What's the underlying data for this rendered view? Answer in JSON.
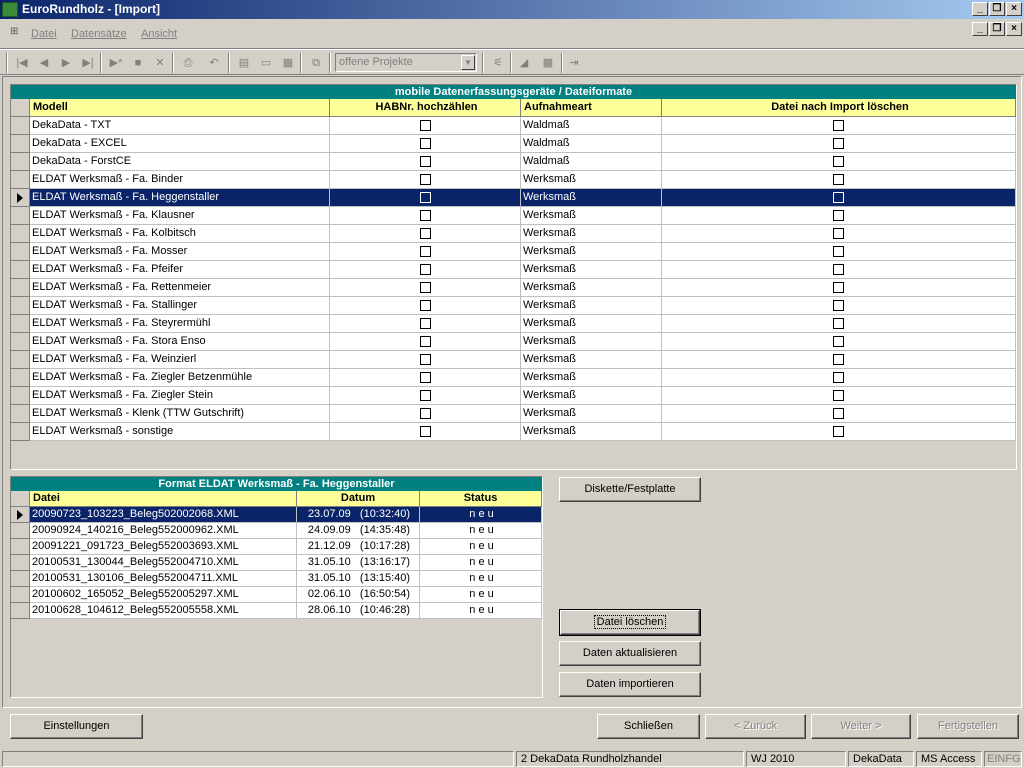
{
  "window": {
    "title": "EuroRundholz - [Import]"
  },
  "menu": {
    "items": [
      "Datei",
      "Datensätze",
      "Ansicht"
    ]
  },
  "toolbar": {
    "project_combo": "offene Projekte"
  },
  "grid1": {
    "title": "mobile Datenerfassungsgeräte  /  Dateiformate",
    "columns": [
      "Modell",
      "HABNr. hochzählen",
      "Aufnahmeart",
      "Datei nach Import löschen"
    ],
    "selected_index": 4,
    "rows": [
      {
        "modell": "DekaData - TXT",
        "aufnahmeart": "Waldmaß"
      },
      {
        "modell": "DekaData - EXCEL",
        "aufnahmeart": "Waldmaß"
      },
      {
        "modell": "DekaData - ForstCE",
        "aufnahmeart": "Waldmaß"
      },
      {
        "modell": "ELDAT Werksmaß - Fa. Binder",
        "aufnahmeart": "Werksmaß"
      },
      {
        "modell": "ELDAT Werksmaß - Fa. Heggenstaller",
        "aufnahmeart": "Werksmaß"
      },
      {
        "modell": "ELDAT Werksmaß - Fa. Klausner",
        "aufnahmeart": "Werksmaß"
      },
      {
        "modell": "ELDAT Werksmaß - Fa. Kolbitsch",
        "aufnahmeart": "Werksmaß"
      },
      {
        "modell": "ELDAT Werksmaß - Fa. Mosser",
        "aufnahmeart": "Werksmaß"
      },
      {
        "modell": "ELDAT Werksmaß - Fa. Pfeifer",
        "aufnahmeart": "Werksmaß"
      },
      {
        "modell": "ELDAT Werksmaß - Fa. Rettenmeier",
        "aufnahmeart": "Werksmaß"
      },
      {
        "modell": "ELDAT Werksmaß - Fa. Stallinger",
        "aufnahmeart": "Werksmaß"
      },
      {
        "modell": "ELDAT Werksmaß - Fa. Steyrermühl",
        "aufnahmeart": "Werksmaß"
      },
      {
        "modell": "ELDAT Werksmaß - Fa. Stora Enso",
        "aufnahmeart": "Werksmaß"
      },
      {
        "modell": "ELDAT Werksmaß - Fa. Weinzierl",
        "aufnahmeart": "Werksmaß"
      },
      {
        "modell": "ELDAT Werksmaß - Fa. Ziegler Betzenmühle",
        "aufnahmeart": "Werksmaß"
      },
      {
        "modell": "ELDAT Werksmaß - Fa. Ziegler Stein",
        "aufnahmeart": "Werksmaß"
      },
      {
        "modell": "ELDAT Werksmaß - Klenk  (TTW Gutschrift)",
        "aufnahmeart": "Werksmaß"
      },
      {
        "modell": "ELDAT Werksmaß - sonstige",
        "aufnahmeart": "Werksmaß"
      }
    ]
  },
  "grid2": {
    "title": "Format   ELDAT Werksmaß - Fa. Heggenstaller",
    "columns": [
      "Datei",
      "Datum",
      "Status"
    ],
    "selected_index": 0,
    "rows": [
      {
        "datei": "20090723_103223_Beleg502002068.XML",
        "datum": "23.07.09   (10:32:40)",
        "status": "n e u"
      },
      {
        "datei": "20090924_140216_Beleg552000962.XML",
        "datum": "24.09.09   (14:35:48)",
        "status": "n e u"
      },
      {
        "datei": "20091221_091723_Beleg552003693.XML",
        "datum": "21.12.09   (10:17:28)",
        "status": "n e u"
      },
      {
        "datei": "20100531_130044_Beleg552004710.XML",
        "datum": "31.05.10   (13:16:17)",
        "status": "n e u"
      },
      {
        "datei": "20100531_130106_Beleg552004711.XML",
        "datum": "31.05.10   (13:15:40)",
        "status": "n e u"
      },
      {
        "datei": "20100602_165052_Beleg552005297.XML",
        "datum": "02.06.10   (16:50:54)",
        "status": "n e u"
      },
      {
        "datei": "20100628_104612_Beleg552005558.XML",
        "datum": "28.06.10   (10:46:28)",
        "status": "n e u"
      }
    ]
  },
  "buttons": {
    "diskette": "Diskette/Festplatte",
    "datei_loeschen": "Datei löschen",
    "daten_aktualisieren": "Daten aktualisieren",
    "daten_importieren": "Daten importieren",
    "einstellungen": "Einstellungen",
    "schliessen": "Schließen",
    "zurueck": "< Zurück",
    "weiter": "Weiter >",
    "fertigstellen": "Fertigstellen"
  },
  "statusbar": {
    "company": "2 DekaData Rundholzhandel",
    "year": "WJ 2010",
    "db": "DekaData",
    "engine": "MS Access",
    "mode": "EINFG"
  },
  "colors": {
    "title_teal": "#008080",
    "header_yellow": "#ffff99",
    "selection": "#0a246a"
  }
}
